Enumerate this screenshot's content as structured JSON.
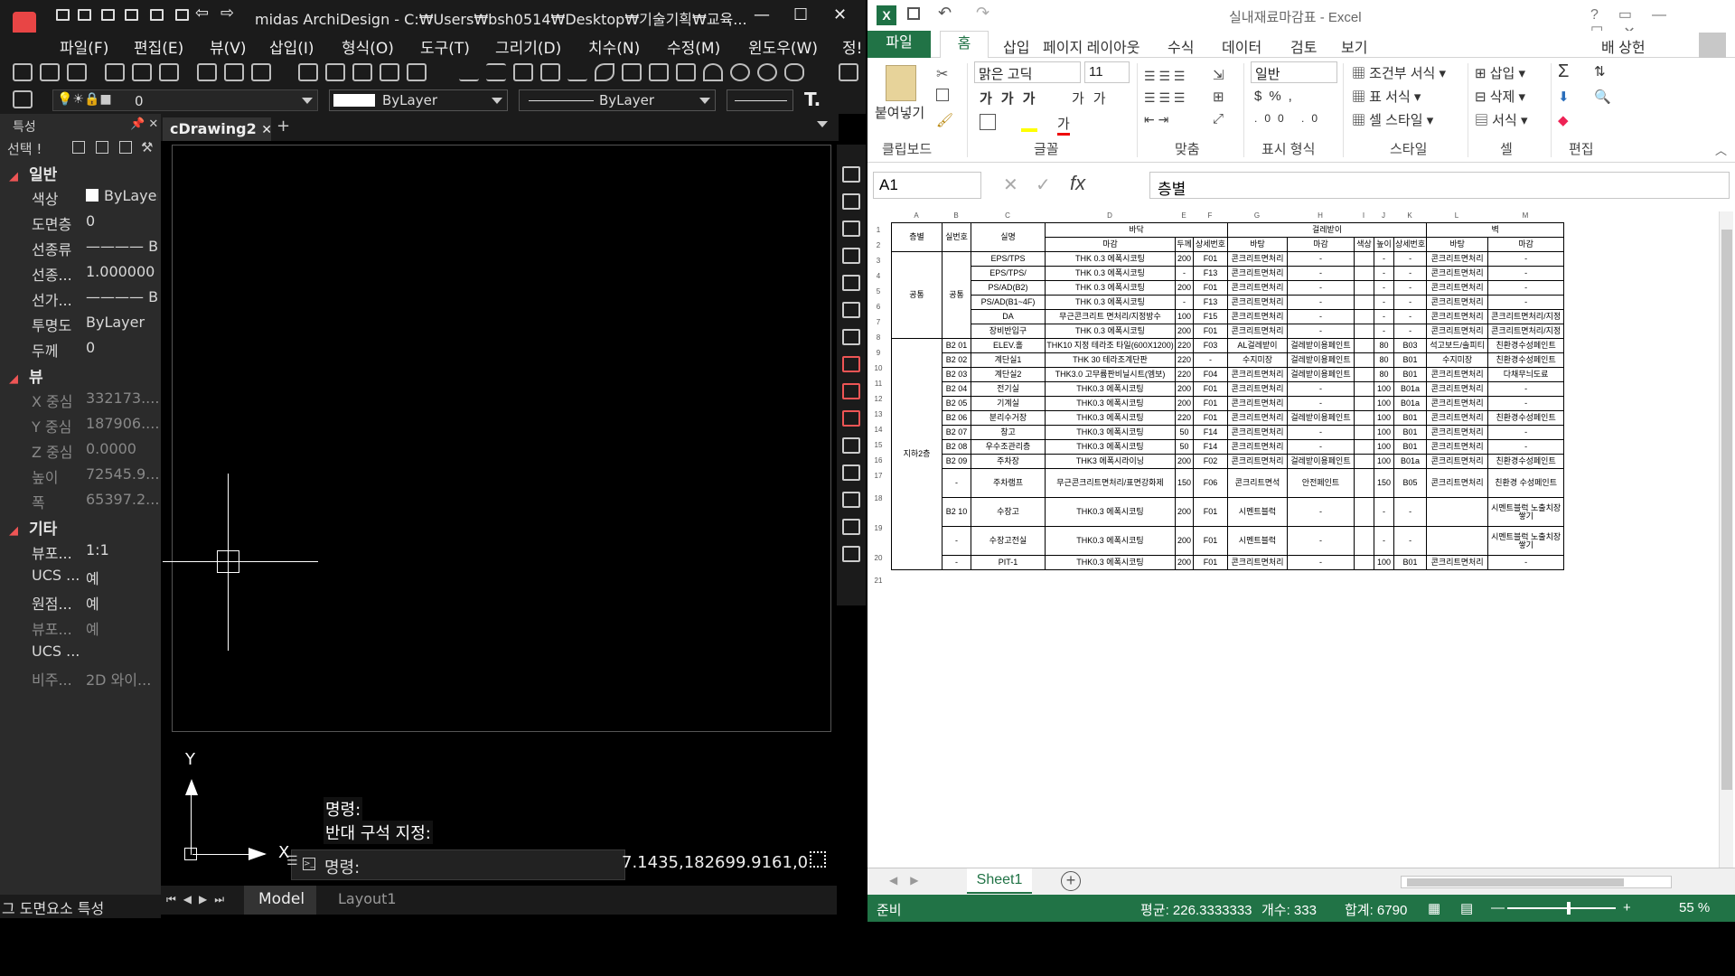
{
  "cad": {
    "title": "midas ArchiDesign - C:₩Users₩bsh0514₩Desktop₩기술기획₩교육...",
    "menu": [
      "파일(F)",
      "편집(E)",
      "뷰(V)",
      "삽입(I)",
      "형식(O)",
      "도구(T)",
      "그리기(D)",
      "치수(N)",
      "수정(M)",
      "윈도우(W)",
      "정!"
    ],
    "layer_value": "0",
    "color_combo": "ByLayer",
    "linetype_combo": "ByLayer",
    "props_title": "특성",
    "selection": "선택 !",
    "sections": {
      "general": "일반",
      "view": "뷰",
      "misc": "기타"
    },
    "props": [
      {
        "k": "색상",
        "v": "ByLayer"
      },
      {
        "k": "도면층",
        "v": "0"
      },
      {
        "k": "선종류",
        "v": "———— By"
      },
      {
        "k": "선종...",
        "v": "1.000000"
      },
      {
        "k": "선가...",
        "v": "———— By"
      },
      {
        "k": "투명도",
        "v": "ByLayer"
      },
      {
        "k": "두께",
        "v": "0"
      },
      {
        "k": "X 중심",
        "v": "332173...."
      },
      {
        "k": "Y 중심",
        "v": "187906...."
      },
      {
        "k": "Z 중심",
        "v": "0.0000"
      },
      {
        "k": "높이",
        "v": "72545.9..."
      },
      {
        "k": "폭",
        "v": "65397.2..."
      },
      {
        "k": "뷰포...",
        "v": "1:1"
      },
      {
        "k": "UCS ...",
        "v": "예"
      },
      {
        "k": "원점...",
        "v": "예"
      },
      {
        "k": "뷰포...",
        "v": "예"
      },
      {
        "k": "UCS ...",
        "v": ""
      },
      {
        "k": "비주...",
        "v": "2D 와이..."
      }
    ],
    "props_tabs": "그 도면요소 특성",
    "doc_tab": "cDrawing2",
    "ucs": {
      "y": "Y",
      "x": "X"
    },
    "cmd_history": [
      "명령:",
      "반대 구석 지정:"
    ],
    "cmd_prompt": "명령:",
    "coords": "7.1435,182699.9161,0",
    "tabs": {
      "model": "Model",
      "layout": "Layout1"
    }
  },
  "excel": {
    "title": "실내재료마감표 - Excel",
    "tabs": [
      "파일",
      "홈",
      "삽입",
      "페이지 레이아웃",
      "수식",
      "데이터",
      "검토",
      "보기"
    ],
    "user": "배 상헌",
    "ribbon": {
      "paste": "붙여넣기",
      "font_name": "맑은 고딕",
      "font_size": "11",
      "number_format": "일반",
      "cond_format": "조건부 서식",
      "table_format": "표 서식",
      "cell_style": "셀 스타일",
      "insert": "삽입",
      "delete": "삭제",
      "format": "서식",
      "groups": [
        "클립보드",
        "글꼴",
        "맞춤",
        "표시 형식",
        "스타일",
        "셀",
        "편집"
      ]
    },
    "namebox": "A1",
    "formula": "층별",
    "col_letters": [
      "A",
      "B",
      "C",
      "D",
      "E",
      "F",
      "G",
      "H",
      "I",
      "J",
      "K",
      "L",
      "M"
    ],
    "row_numbers": [
      "1",
      "2",
      "3",
      "4",
      "5",
      "6",
      "7",
      "8",
      "9",
      "10",
      "11",
      "12",
      "13",
      "14",
      "15",
      "16",
      "17",
      "18",
      "19",
      "20",
      "21"
    ],
    "headers": {
      "floor": "층별",
      "room_no": "실번호",
      "room": "실명",
      "floor_finish": "바닥",
      "skirting": "걸레받이",
      "wall": "벽",
      "finish": "마감",
      "thick": "두께",
      "detail": "상세번호",
      "base": "바탕",
      "color": "색상",
      "height": "높이"
    },
    "groups": {
      "common": "공통",
      "b2": "지하2층"
    },
    "rows": [
      {
        "b": "",
        "c": "EPS/TPS",
        "d": "THK 0.3 에폭시코팅",
        "e": "200",
        "f": "F01",
        "g": "콘크리트면처리",
        "h": "-",
        "i": "",
        "j": "-",
        "k": "-",
        "l": "콘크리트면처리",
        "m": "-"
      },
      {
        "b": "",
        "c": "EPS/TPS/",
        "d": "THK 0.3 에폭시코팅",
        "e": "-",
        "f": "F13",
        "g": "콘크리트면처리",
        "h": "-",
        "i": "",
        "j": "-",
        "k": "-",
        "l": "콘크리트면처리",
        "m": "-"
      },
      {
        "b": "",
        "c": "PS/AD(B2)",
        "d": "THK 0.3 에폭시코팅",
        "e": "200",
        "f": "F01",
        "g": "콘크리트면처리",
        "h": "-",
        "i": "",
        "j": "-",
        "k": "-",
        "l": "콘크리트면처리",
        "m": "-"
      },
      {
        "b": "",
        "c": "PS/AD(B1~4F)",
        "d": "THK 0.3 에폭시코팅",
        "e": "-",
        "f": "F13",
        "g": "콘크리트면처리",
        "h": "-",
        "i": "",
        "j": "-",
        "k": "-",
        "l": "콘크리트면처리",
        "m": "-"
      },
      {
        "b": "",
        "c": "DA",
        "d": "무근콘크리트 면처리/지정방수",
        "e": "100",
        "f": "F15",
        "g": "콘크리트면처리",
        "h": "-",
        "i": "",
        "j": "-",
        "k": "-",
        "l": "콘크리트면처리",
        "m": "콘크리트면처리/지정"
      },
      {
        "b": "",
        "c": "장비반입구",
        "d": "THK 0.3 에폭시코팅",
        "e": "200",
        "f": "F01",
        "g": "콘크리트면처리",
        "h": "-",
        "i": "",
        "j": "-",
        "k": "-",
        "l": "콘크리트면처리",
        "m": "콘크리트면처리/지정"
      },
      {
        "b": "B2 01",
        "c": "ELEV.홀",
        "d": "THK10 지정 테라조 타일(600X1200)",
        "e": "220",
        "f": "F03",
        "g": "AL걸레받이",
        "h": "걸레받이용페인트",
        "i": "",
        "j": "80",
        "k": "B03",
        "l": "석고보드/솔피티",
        "m": "친환경수성페인트"
      },
      {
        "b": "B2 02",
        "c": "계단실1",
        "d": "THK 30 테라조계단판",
        "e": "220",
        "f": "-",
        "g": "수지미장",
        "h": "걸레받이용페인트",
        "i": "",
        "j": "80",
        "k": "B01",
        "l": "수지미장",
        "m": "친환경수성페인트"
      },
      {
        "b": "B2 03",
        "c": "계단실2",
        "d": "THK3.0 고무륨판비닐시트(엠보)",
        "e": "220",
        "f": "F04",
        "g": "콘크리트면처리",
        "h": "걸레받이용페인트",
        "i": "",
        "j": "80",
        "k": "B01",
        "l": "콘크리트면처리",
        "m": "다채무늬도료"
      },
      {
        "b": "B2 04",
        "c": "전기실",
        "d": "THK0.3 에폭시코팅",
        "e": "200",
        "f": "F01",
        "g": "콘크리트면처리",
        "h": "-",
        "i": "",
        "j": "100",
        "k": "B01a",
        "l": "콘크리트면처리",
        "m": "-"
      },
      {
        "b": "B2 05",
        "c": "기계실",
        "d": "THK0.3 에폭시코팅",
        "e": "200",
        "f": "F01",
        "g": "콘크리트면처리",
        "h": "-",
        "i": "",
        "j": "100",
        "k": "B01a",
        "l": "콘크리트면처리",
        "m": "-"
      },
      {
        "b": "B2 06",
        "c": "분리수거장",
        "d": "THK0.3 에폭시코팅",
        "e": "220",
        "f": "F01",
        "g": "콘크리트면처리",
        "h": "걸레받이용페인트",
        "i": "",
        "j": "100",
        "k": "B01",
        "l": "콘크리트면처리",
        "m": "친환경수성페인트"
      },
      {
        "b": "B2 07",
        "c": "창고",
        "d": "THK0.3 에폭시코팅",
        "e": "50",
        "f": "F14",
        "g": "콘크리트면처리",
        "h": "-",
        "i": "",
        "j": "100",
        "k": "B01",
        "l": "콘크리트면처리",
        "m": "-"
      },
      {
        "b": "B2 08",
        "c": "우수조관리층",
        "d": "THK0.3 에폭시코팅",
        "e": "50",
        "f": "F14",
        "g": "콘크리트면처리",
        "h": "-",
        "i": "",
        "j": "100",
        "k": "B01",
        "l": "콘크리트면처리",
        "m": "-"
      },
      {
        "b": "B2 09",
        "c": "주차장",
        "d": "THK3 에폭시라이닝",
        "e": "200",
        "f": "F02",
        "g": "콘크리트면처리",
        "h": "걸레받이용페인트",
        "i": "",
        "j": "100",
        "k": "B01a",
        "l": "콘크리트면처리",
        "m": "친환경수성페인트"
      },
      {
        "b": "-",
        "c": "주차램프",
        "d": "무근콘크리트면처리/표면강화제",
        "e": "150",
        "f": "F06",
        "g": "콘크리트면석",
        "h": "안전페인트",
        "i": "",
        "j": "150",
        "k": "B05",
        "l": "콘크리트면처리",
        "m": "친환경 수성페인트"
      },
      {
        "b": "B2 10",
        "c": "수장고",
        "d": "THK0.3 에폭시코팅",
        "e": "200",
        "f": "F01",
        "g": "시멘트블럭",
        "h": "-",
        "i": "",
        "j": "-",
        "k": "-",
        "l": "",
        "m": "시멘트블럭 노출치장쌓기"
      },
      {
        "b": "-",
        "c": "수장고전실",
        "d": "THK0.3 에폭시코팅",
        "e": "200",
        "f": "F01",
        "g": "시멘트블럭",
        "h": "-",
        "i": "",
        "j": "-",
        "k": "-",
        "l": "",
        "m": "시멘트블럭 노출치장쌓기"
      },
      {
        "b": "-",
        "c": "PIT-1",
        "d": "THK0.3 에폭시코팅",
        "e": "200",
        "f": "F01",
        "g": "콘크리트면처리",
        "h": "-",
        "i": "",
        "j": "100",
        "k": "B01",
        "l": "콘크리트면처리",
        "m": "-"
      }
    ],
    "sheet_tab": "Sheet1",
    "status": {
      "ready": "준비",
      "avg": "평균: 226.3333333",
      "count": "개수: 333",
      "sum": "합계: 6790",
      "zoom": "55 %"
    }
  }
}
